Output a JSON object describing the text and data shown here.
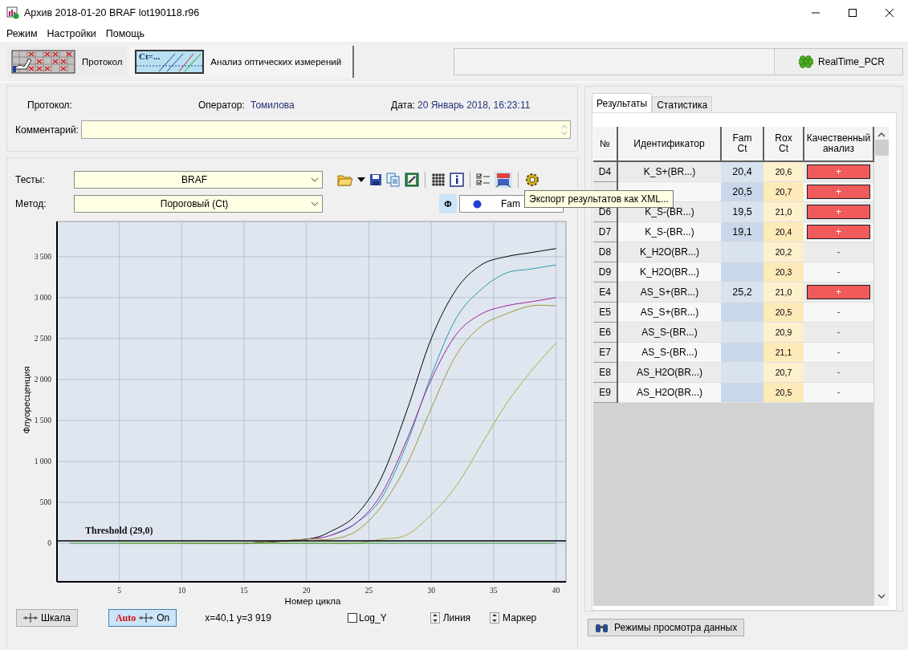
{
  "window": {
    "title": "Архив 2018-01-20 BRAF lot190118.r96"
  },
  "menu": [
    "Режим",
    "Настройки",
    "Помощь"
  ],
  "mode_tabs": [
    {
      "label": "Протокол",
      "selected": false,
      "kind": "protocol"
    },
    {
      "label": "Анализ оптических измерений",
      "selected": true,
      "kind": "analysis",
      "icon_text": "Ct=..."
    }
  ],
  "app_button": "RealTime_PCR",
  "info": {
    "protocol_label": "Протокол:",
    "operator_label": "Оператор:",
    "operator": "Томилова",
    "date_label": "Дата:",
    "date": "20 Январь 2018, 16:23:11",
    "comment_label": "Комментарий:"
  },
  "tests": {
    "label": "Тесты:",
    "value": "BRAF"
  },
  "method": {
    "label": "Метод:",
    "value": "Пороговый (Ct)"
  },
  "phi_button": {
    "label": "Ф",
    "pressed": true
  },
  "channel": {
    "value": "Fam"
  },
  "tooltip": "Экспорт результатов как XML...",
  "chart": {
    "chart_data": {
      "type": "line",
      "xlabel": "Номер цикла",
      "ylabel": "Флуоресценция",
      "x": [
        1,
        5,
        10,
        15,
        20,
        22,
        24,
        26,
        28,
        30,
        32,
        34,
        36,
        38,
        40
      ],
      "series": [
        {
          "color": "#000000",
          "values": [
            null,
            null,
            null,
            0,
            50,
            150,
            350,
            800,
            1600,
            2500,
            3100,
            3400,
            3500,
            3550,
            3600
          ]
        },
        {
          "color": "#2a9aa8",
          "values": [
            null,
            null,
            null,
            null,
            null,
            100,
            250,
            550,
            1200,
            2050,
            2750,
            3100,
            3300,
            3350,
            3400
          ]
        },
        {
          "color": "#a0209a",
          "values": [
            null,
            null,
            null,
            0,
            50,
            100,
            250,
            600,
            1250,
            2000,
            2550,
            2800,
            2900,
            2950,
            3000
          ]
        },
        {
          "color": "#9a9a30",
          "values": [
            null,
            null,
            0,
            0,
            50,
            50,
            150,
            450,
            950,
            1650,
            2300,
            2650,
            2800,
            2900,
            2900
          ]
        },
        {
          "color": "#a8b040",
          "values": [
            null,
            0,
            0,
            0,
            0,
            0,
            0,
            50,
            100,
            350,
            700,
            1200,
            1700,
            2100,
            2450
          ]
        },
        {
          "color": "#40a040",
          "values": [
            0,
            0,
            0,
            0,
            0,
            0,
            0,
            0,
            0,
            0,
            0,
            0,
            0,
            0,
            0
          ]
        }
      ],
      "grid": true,
      "xlim": [
        0,
        40.8
      ],
      "ylim": [
        -470,
        3930
      ],
      "xticks": [
        5,
        10,
        15,
        20,
        25,
        30,
        35,
        40
      ],
      "yticks": [
        {
          "value": 0,
          "label": "0"
        },
        {
          "value": 500,
          "label": "500"
        },
        {
          "value": 1000,
          "label": "1 000"
        },
        {
          "value": 1500,
          "label": "1 500"
        },
        {
          "value": 2000,
          "label": "2 000"
        },
        {
          "value": 2500,
          "label": "2 500"
        },
        {
          "value": 3000,
          "label": "3 000"
        },
        {
          "value": 3500,
          "label": "3 500"
        }
      ],
      "ref_lines": [
        {
          "axis": "y",
          "value": 30,
          "label": "Threshold (29,0)"
        }
      ]
    }
  },
  "scale_button": "Шкала",
  "auto_button": {
    "label_bold": "Auto",
    "label": "On",
    "on": true
  },
  "coord_readout": "x=40,1 y=3 919",
  "log_y": {
    "label": "Log_Y",
    "checked": false
  },
  "spinners": [
    "Линия",
    "Маркер"
  ],
  "result_tabs": [
    {
      "label": "Результаты",
      "selected": true
    },
    {
      "label": "Статистика",
      "selected": false
    }
  ],
  "table": {
    "columns": [
      "№",
      "Идентификатор",
      "Fam Ct",
      "Rox Ct",
      "Качественный анализ"
    ],
    "rows": [
      {
        "well": "D4",
        "id": "K_S+(BR...)",
        "fam_ct": "20,4",
        "rox_ct": "20,6",
        "result": "+",
        "positive": true
      },
      {
        "fam_ct": "20,5",
        "rox_ct": "20,7",
        "result": "+",
        "positive": true
      },
      {
        "well": "D6",
        "id": "K_S-(BR...)",
        "fam_ct": "19,5",
        "rox_ct": "21,0",
        "result": "+",
        "positive": true
      },
      {
        "well": "D7",
        "id": "K_S-(BR...)",
        "fam_ct": "19,1",
        "rox_ct": "20,4",
        "result": "+",
        "positive": true
      },
      {
        "well": "D8",
        "id": "K_H2O(BR...)",
        "rox_ct": "20,2",
        "result": "-",
        "positive": false
      },
      {
        "well": "D9",
        "id": "K_H2O(BR...)",
        "rox_ct": "20,3",
        "result": "-",
        "positive": false
      },
      {
        "well": "E4",
        "id": "AS_S+(BR...)",
        "fam_ct": "25,2",
        "rox_ct": "21,0",
        "result": "+",
        "positive": true
      },
      {
        "well": "E5",
        "id": "AS_S+(BR...)",
        "rox_ct": "20,5",
        "result": "-",
        "positive": false
      },
      {
        "well": "E6",
        "id": "AS_S-(BR...)",
        "rox_ct": "20,9",
        "result": "-",
        "positive": false
      },
      {
        "well": "E7",
        "id": "AS_S-(BR...)",
        "rox_ct": "21,1",
        "result": "-",
        "positive": false
      },
      {
        "well": "E8",
        "id": "AS_H2O(BR...)",
        "rox_ct": "20,7",
        "result": "-",
        "positive": false
      },
      {
        "well": "E9",
        "id": "AS_H2O(BR...)",
        "rox_ct": "20,5",
        "result": "-",
        "positive": false
      }
    ]
  },
  "view_modes_button": "Режимы просмотра данных"
}
